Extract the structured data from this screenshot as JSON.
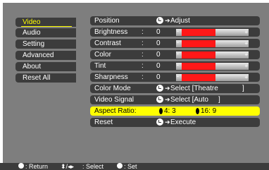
{
  "menu": [
    {
      "label": "Video",
      "active": true
    },
    {
      "label": "Audio"
    },
    {
      "label": "Setting"
    },
    {
      "label": "Advanced"
    },
    {
      "label": "About"
    },
    {
      "label": "Reset All"
    }
  ],
  "rows": {
    "position": {
      "label": "Position",
      "action": "Adjust"
    },
    "brightness": {
      "label": "Brightness",
      "colon": ":",
      "value": "0",
      "level": 0.5
    },
    "contrast": {
      "label": "Contrast",
      "colon": ":",
      "value": "0",
      "level": 0.5
    },
    "color": {
      "label": "Color",
      "colon": ":",
      "value": "0",
      "level": 0.5
    },
    "tint": {
      "label": "Tint",
      "colon": ":",
      "value": "0",
      "level": 0.5
    },
    "sharpness": {
      "label": "Sharpness",
      "colon": ":",
      "value": "0",
      "level": 0.5
    },
    "color_mode": {
      "label": "Color Mode",
      "action": "Select [Theatre",
      "close": "]"
    },
    "video_signal": {
      "label": "Video Signal",
      "action": "Select [Auto",
      "close": "]"
    },
    "aspect_ratio": {
      "label": "Aspect Ratio:",
      "opt1": "4: 3",
      "opt2": "16: 9"
    },
    "reset": {
      "label": "Reset",
      "action": "Execute"
    }
  },
  "bar_signs": {
    "minus": "-",
    "plus": "+"
  },
  "footer": {
    "return": ": Return",
    "select": ": Select",
    "set": ": Set"
  },
  "colors": {
    "highlight": "#ffff00",
    "bar_fill": "#ff1818",
    "panel": "#3c3c3c"
  }
}
